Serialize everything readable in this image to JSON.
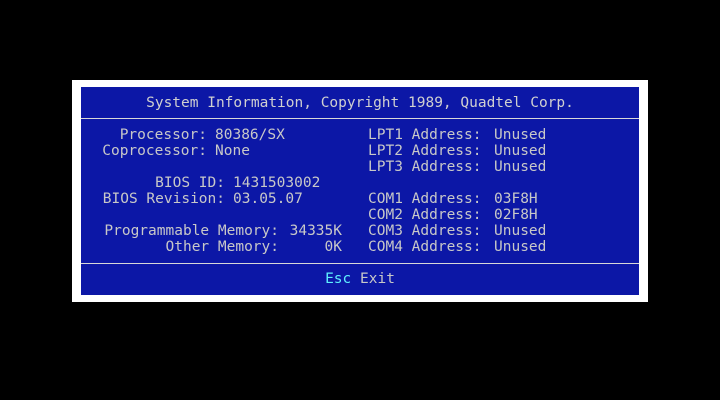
{
  "title": "System Information, Copyright 1989, Quadtel Corp.",
  "left": {
    "processor_label": "Processor:",
    "processor_value": "80386/SX",
    "coprocessor_label": "Coprocessor:",
    "coprocessor_value": "None",
    "bios_id_label": "BIOS ID:",
    "bios_id_value": "1431503002",
    "bios_revision_label": "BIOS Revision:",
    "bios_revision_value": "03.05.07",
    "prog_memory_label": "Programmable Memory:",
    "prog_memory_value": "34335K",
    "other_memory_label": "Other Memory:",
    "other_memory_value": "0K"
  },
  "ports": [
    {
      "label": "LPT1 Address:",
      "value": "Unused"
    },
    {
      "label": "LPT2 Address:",
      "value": "Unused"
    },
    {
      "label": "LPT3 Address:",
      "value": "Unused"
    },
    {
      "label": "COM1 Address:",
      "value": "03F8H"
    },
    {
      "label": "COM2 Address:",
      "value": "02F8H"
    },
    {
      "label": "COM3 Address:",
      "value": "Unused"
    },
    {
      "label": "COM4 Address:",
      "value": "Unused"
    }
  ],
  "footer": {
    "key": "Esc",
    "action": "Exit"
  },
  "colors": {
    "panel": "#0c17a6",
    "frame": "#ffffff",
    "text": "#c8c8c8",
    "hotkey": "#5ff0ff"
  }
}
